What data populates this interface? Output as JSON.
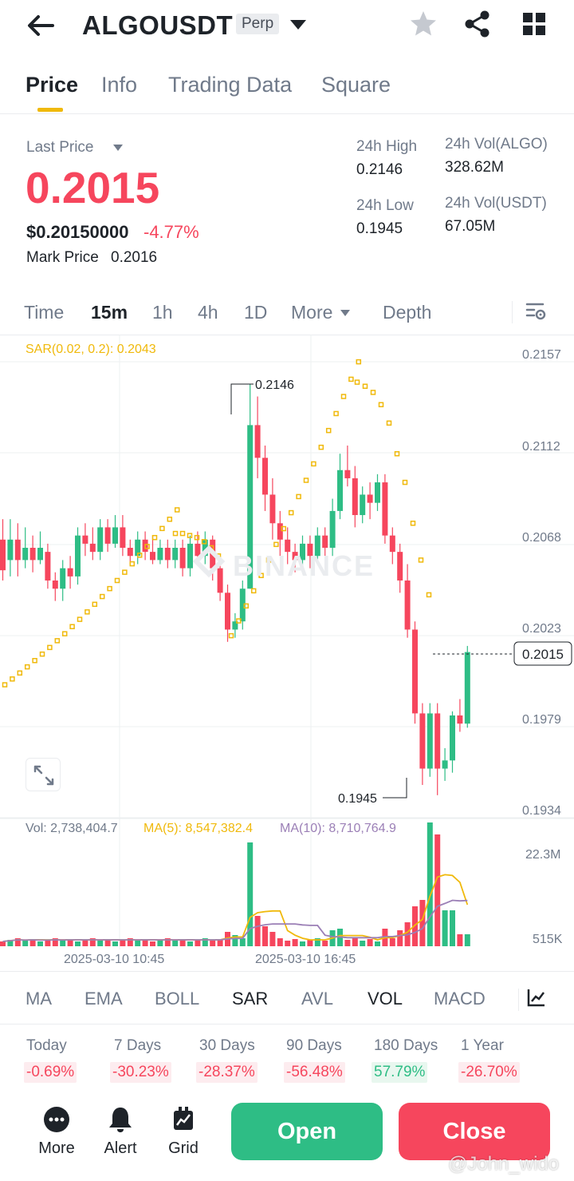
{
  "header": {
    "symbol": "ALGOUSDT",
    "contract_type": "Perp",
    "icons": [
      "back-arrow-icon",
      "star-icon",
      "share-icon",
      "grid-icon"
    ]
  },
  "tabs": [
    {
      "label": "Price",
      "active": true
    },
    {
      "label": "Info",
      "active": false
    },
    {
      "label": "Trading Data",
      "active": false
    },
    {
      "label": "Square",
      "active": false
    }
  ],
  "price": {
    "last_price_label": "Last Price",
    "last_price": "0.2015",
    "usd_price": "$0.20150000",
    "change_pct": "-4.77%",
    "mark_price_label": "Mark Price",
    "mark_price": "0.2016"
  },
  "stats": {
    "high_label": "24h High",
    "high": "0.2146",
    "low_label": "24h Low",
    "low": "0.1945",
    "vol_algo_label": "24h Vol(ALGO)",
    "vol_algo": "328.62M",
    "vol_usdt_label": "24h Vol(USDT)",
    "vol_usdt": "67.05M"
  },
  "timeframes": {
    "items": [
      "Time",
      "15m",
      "1h",
      "4h",
      "1D",
      "More"
    ],
    "active": "15m",
    "depth_label": "Depth"
  },
  "chart": {
    "sar_label": "SAR(0.02, 0.2): 0.2043",
    "price_axis": [
      "0.2157",
      "0.2112",
      "0.2068",
      "0.2023",
      "0.1979",
      "0.1934"
    ],
    "current_price_tag": "0.2015",
    "high_marker": "0.2146",
    "low_marker": "0.1945",
    "watermark": "BINANCE",
    "vol_label": "Vol: 2,738,404.7",
    "ma5_label": "MA(5): 8,547,382.4",
    "ma10_label": "MA(10): 8,710,764.9",
    "vol_axis": [
      "22.3M",
      "515K"
    ],
    "time_axis": [
      "2025-03-10 10:45",
      "2025-03-10 16:45"
    ],
    "colors": {
      "up": "#2ebd85",
      "down": "#f6465d",
      "sar": "#f0b90b",
      "ma5": "#f0b90b",
      "ma10": "#9b7fb6"
    }
  },
  "indicators": {
    "items": [
      "MA",
      "EMA",
      "BOLL",
      "SAR",
      "AVL",
      "VOL",
      "MACD"
    ],
    "active": [
      "SAR",
      "VOL"
    ]
  },
  "performance": [
    {
      "label": "Today",
      "value": "-0.69%",
      "positive": false
    },
    {
      "label": "7 Days",
      "value": "-30.23%",
      "positive": false
    },
    {
      "label": "30 Days",
      "value": "-28.37%",
      "positive": false
    },
    {
      "label": "90 Days",
      "value": "-56.48%",
      "positive": false
    },
    {
      "label": "180 Days",
      "value": "57.79%",
      "positive": true
    },
    {
      "label": "1 Year",
      "value": "-26.70%",
      "positive": false
    }
  ],
  "bottom_bar": {
    "more_label": "More",
    "alert_label": "Alert",
    "grid_label": "Grid",
    "open_label": "Open",
    "close_label": "Close"
  },
  "watermark_user": "@John_wido"
}
